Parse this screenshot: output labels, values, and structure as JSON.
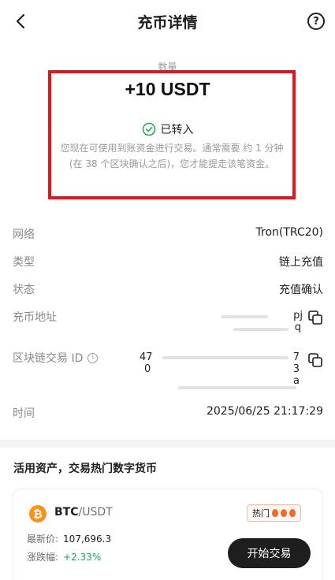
{
  "header": {
    "title": "充币详情"
  },
  "summary": {
    "amount_label": "数量",
    "amount": "+10 USDT",
    "status": "已转入",
    "notice": "您现在可使用到账资金进行交易。通常需要 约 1 分钟 (在 38 个区块确认之后)，您才能提走该笔资金。"
  },
  "details": {
    "network": {
      "label": "网络",
      "value": "Tron(TRC20)"
    },
    "type": {
      "label": "类型",
      "value": "链上充值"
    },
    "status": {
      "label": "状态",
      "value": "充值确认"
    },
    "address": {
      "label": "充币地址",
      "visible_fragments": [
        "pj",
        "q"
      ]
    },
    "txid": {
      "label": "区块链交易 ID",
      "visible_fragments": [
        "47",
        "0",
        "7",
        "3",
        "a"
      ]
    },
    "time": {
      "label": "时间",
      "value": "2025/06/25 21:17:29"
    }
  },
  "promo": {
    "title": "活用资产，交易热门数字货币",
    "card": {
      "base": "BTC",
      "quote": "/USDT",
      "hot_label": "热门",
      "price_label": "最新价:",
      "price": "107,696.3",
      "change_label": "涨跌幅:",
      "change": "+2.33%",
      "trade_button": "开始交易"
    }
  },
  "colors": {
    "highlight": "#e8141b",
    "success": "#1fa64a",
    "btc": "#f7931a",
    "button": "#1e1e1e"
  },
  "icons": [
    "back-icon",
    "help-icon",
    "check-circle-icon",
    "info-icon",
    "copy-icon",
    "bitcoin-icon",
    "flame-icon"
  ]
}
